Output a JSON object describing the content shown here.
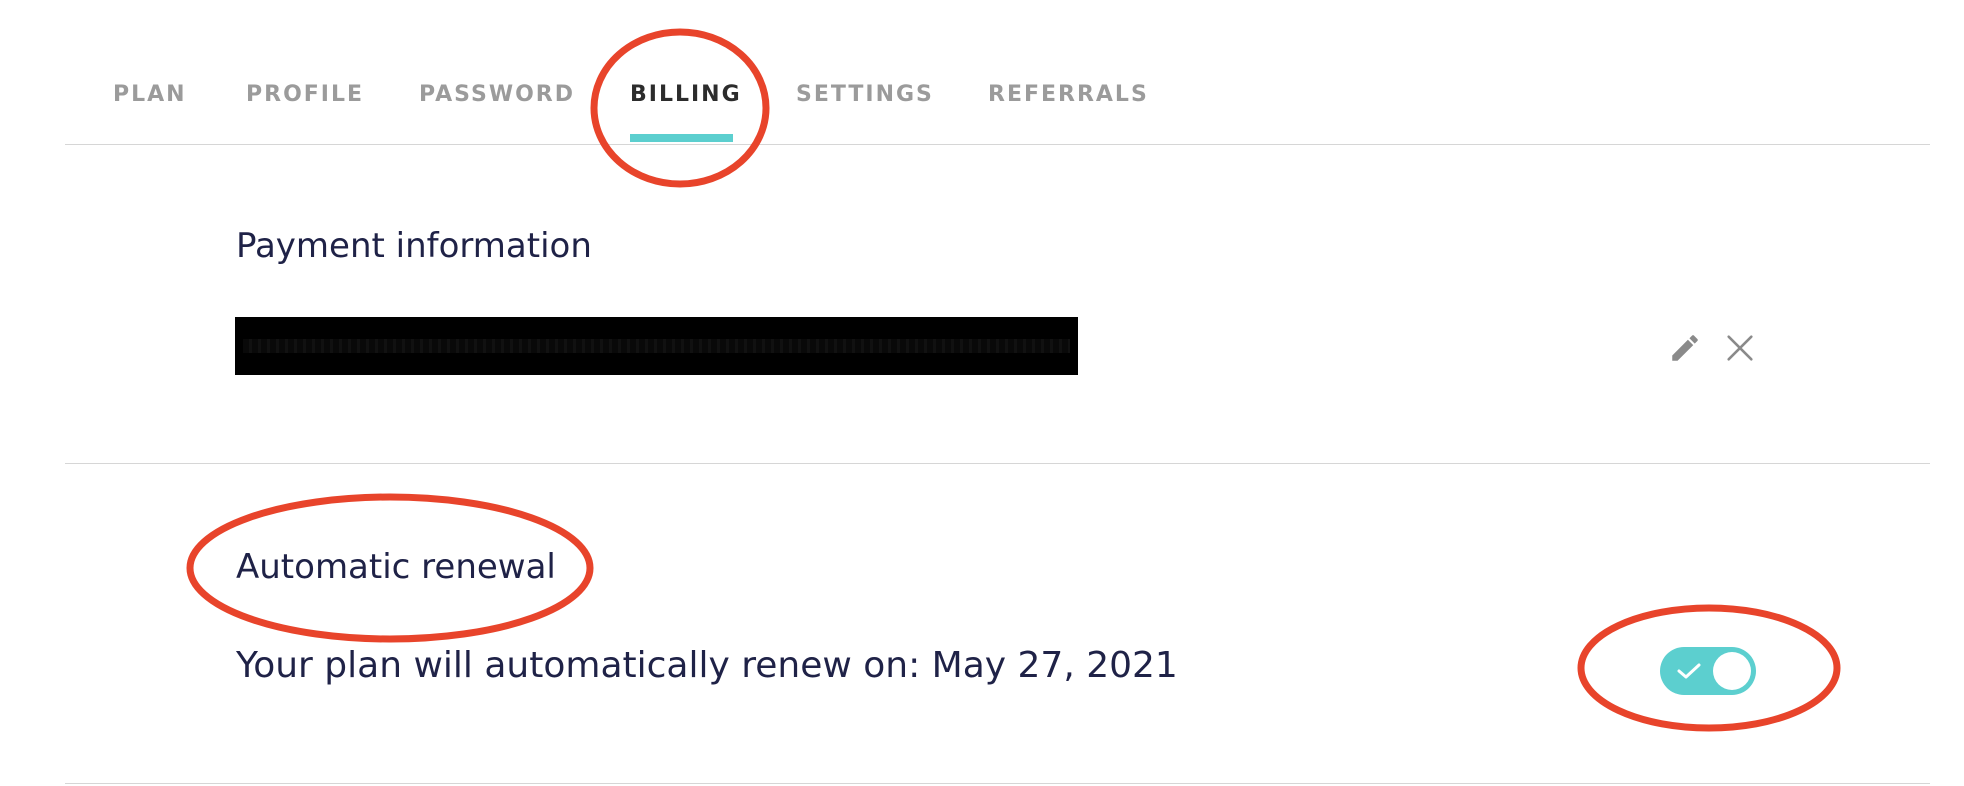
{
  "tabs": [
    {
      "label": "PLAN",
      "active": false
    },
    {
      "label": "PROFILE",
      "active": false
    },
    {
      "label": "PASSWORD",
      "active": false
    },
    {
      "label": "BILLING",
      "active": true
    },
    {
      "label": "SETTINGS",
      "active": false
    },
    {
      "label": "REFERRALS",
      "active": false
    }
  ],
  "payment": {
    "title": "Payment information",
    "card_details": "",
    "edit_icon": "pencil-icon",
    "remove_icon": "close-icon"
  },
  "renewal": {
    "title": "Automatic renewal",
    "text": "Your plan will automatically renew on: May 27, 2021",
    "enabled": true,
    "toggle_icon": "checkmark-icon"
  },
  "colors": {
    "accent": "#5ccfcf",
    "text": "#1f2247",
    "tab_inactive": "#9b9b9b",
    "tab_active": "#2c2c2c",
    "annotation": "#e8442b",
    "divider": "#d6d6d6"
  }
}
